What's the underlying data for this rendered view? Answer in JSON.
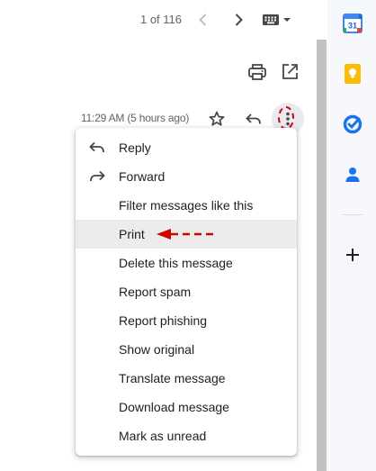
{
  "pager": {
    "text": "1 of 116"
  },
  "icons": {
    "prev": "chevron-left-icon",
    "next": "chevron-right-icon",
    "keyboard": "keyboard-icon",
    "print": "print-icon",
    "open_new": "open-in-new-window-icon",
    "star": "star-icon",
    "reply": "reply-icon",
    "more": "more-vert-icon"
  },
  "message": {
    "time": "11:29 AM (5 hours ago)"
  },
  "menu": {
    "items": [
      {
        "label": "Reply",
        "icon": "reply-icon"
      },
      {
        "label": "Forward",
        "icon": "forward-icon"
      },
      {
        "label": "Filter messages like this"
      },
      {
        "label": "Print",
        "highlighted": true
      },
      {
        "label": "Delete this message"
      },
      {
        "label": "Report spam"
      },
      {
        "label": "Report phishing"
      },
      {
        "label": "Show original"
      },
      {
        "label": "Translate message"
      },
      {
        "label": "Download message"
      },
      {
        "label": "Mark as unread"
      }
    ]
  },
  "side_panel": {
    "calendar_day": "31",
    "apps": [
      "calendar-icon",
      "keep-icon",
      "tasks-icon",
      "contacts-icon",
      "add-icon"
    ]
  },
  "colors": {
    "annotation_red": "#d50000",
    "highlight": "#ececec",
    "side_panel_bg": "#f6f8fc"
  }
}
